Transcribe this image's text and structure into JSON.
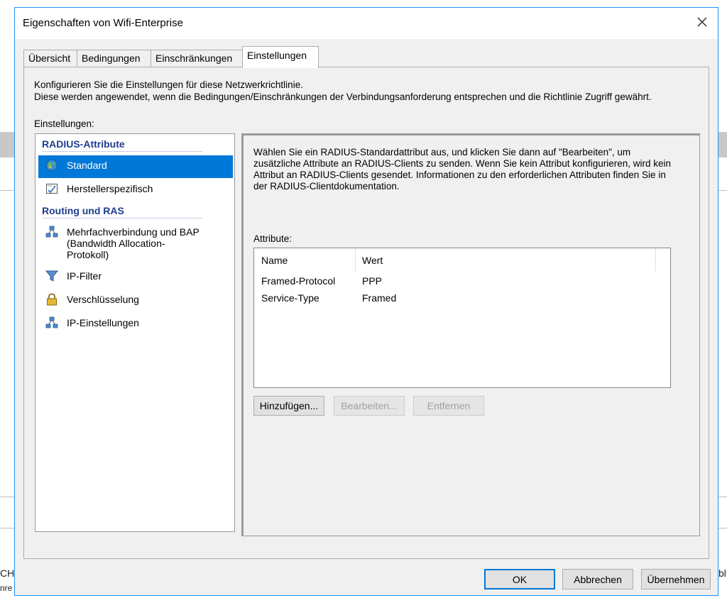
{
  "background": {
    "left_text_1": "CH",
    "left_text_2": "nre",
    "right_text": "bl"
  },
  "window": {
    "title": "Eigenschaften von Wifi-Enterprise",
    "close_icon": "close-icon"
  },
  "tabs": [
    {
      "label": "Übersicht",
      "active": false
    },
    {
      "label": "Bedingungen",
      "active": false
    },
    {
      "label": "Einschränkungen",
      "active": false
    },
    {
      "label": "Einstellungen",
      "active": true
    }
  ],
  "intro": {
    "line1": "Konfigurieren Sie die Einstellungen für diese Netzwerkrichtlinie.",
    "line2": "Diese werden angewendet, wenn die Bedingungen/Einschränkungen der Verbindungsanforderung entsprechen und die Richtlinie Zugriff gewährt."
  },
  "settings_label": "Einstellungen:",
  "settings_tree": {
    "groups": [
      {
        "header": "RADIUS-Attribute",
        "items": [
          {
            "label": "Standard",
            "icon": "globe-icon",
            "selected": true
          },
          {
            "label": "Herstellerspezifisch",
            "icon": "checklist-icon",
            "selected": false
          }
        ]
      },
      {
        "header": "Routing und RAS",
        "items": [
          {
            "label": "Mehrfachverbindung und BAP (Bandwidth Allocation-Protokoll)",
            "icon": "network-icon",
            "selected": false
          },
          {
            "label": "IP-Filter",
            "icon": "funnel-icon",
            "selected": false
          },
          {
            "label": "Verschlüsselung",
            "icon": "lock-icon",
            "selected": false
          },
          {
            "label": "IP-Einstellungen",
            "icon": "network-icon",
            "selected": false
          }
        ]
      }
    ]
  },
  "detail": {
    "description": "Wählen Sie ein RADIUS-Standardattribut aus, und klicken Sie dann auf \"Bearbeiten\", um zusätzliche Attribute an RADIUS-Clients zu senden. Wenn Sie kein Attribut konfigurieren, wird kein Attribut an RADIUS-Clients gesendet. Informationen zu den erforderlichen Attributen finden Sie in der RADIUS-Clientdokumentation.",
    "attributes_label": "Attribute:",
    "columns": [
      "Name",
      "Wert"
    ],
    "rows": [
      {
        "name": "Framed-Protocol",
        "value": "PPP"
      },
      {
        "name": "Service-Type",
        "value": "Framed"
      }
    ],
    "buttons": {
      "add": "Hinzufügen...",
      "edit": "Bearbeiten...",
      "remove": "Entfernen"
    }
  },
  "footer": {
    "ok": "OK",
    "cancel": "Abbrechen",
    "apply": "Übernehmen"
  },
  "colors": {
    "accent": "#0078d7",
    "header_blue": "#1f3d8c",
    "dialog_bg": "#f0f0f0"
  }
}
